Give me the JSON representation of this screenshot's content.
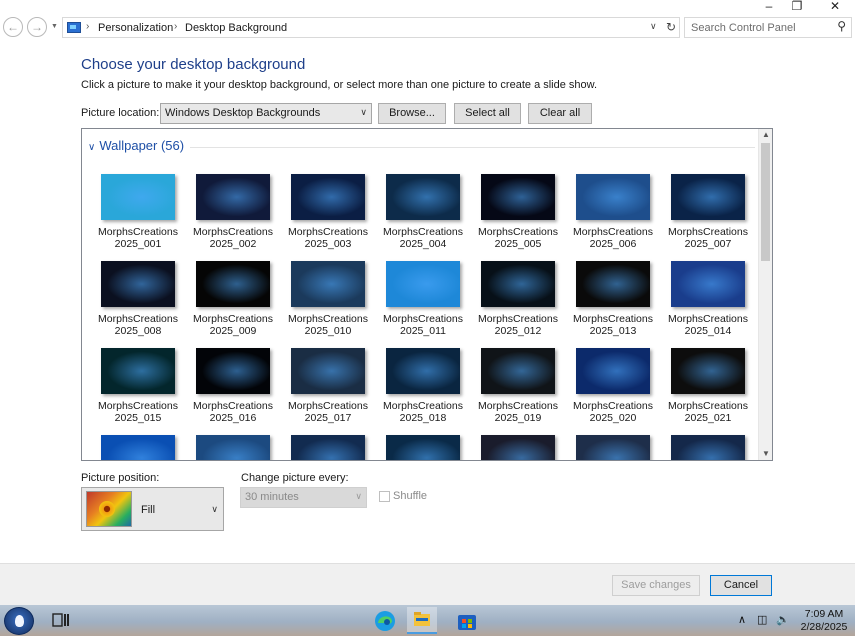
{
  "window": {
    "minimize": "–",
    "maximize": "❐",
    "close": "✕"
  },
  "address": {
    "crumbs": [
      "Personalization",
      "Desktop Background"
    ],
    "search_placeholder": "Search Control Panel"
  },
  "header": {
    "title": "Choose your desktop background",
    "instruction": "Click a picture to make it your desktop background, or select more than one picture to create a slide show."
  },
  "location": {
    "label": "Picture location:",
    "value": "Windows Desktop Backgrounds",
    "browse": "Browse...",
    "select_all": "Select all",
    "clear_all": "Clear all"
  },
  "gallery": {
    "group_title": "Wallpaper (56)",
    "items": [
      {
        "line1": "MorphsCreations",
        "line2": "2025_001"
      },
      {
        "line1": "MorphsCreations",
        "line2": "2025_002"
      },
      {
        "line1": "MorphsCreations",
        "line2": "2025_003"
      },
      {
        "line1": "MorphsCreations",
        "line2": "2025_004"
      },
      {
        "line1": "MorphsCreations",
        "line2": "2025_005"
      },
      {
        "line1": "MorphsCreations",
        "line2": "2025_006"
      },
      {
        "line1": "MorphsCreations",
        "line2": "2025_007"
      },
      {
        "line1": "MorphsCreations",
        "line2": "2025_008"
      },
      {
        "line1": "MorphsCreations",
        "line2": "2025_009"
      },
      {
        "line1": "MorphsCreations",
        "line2": "2025_010"
      },
      {
        "line1": "MorphsCreations",
        "line2": "2025_011"
      },
      {
        "line1": "MorphsCreations",
        "line2": "2025_012"
      },
      {
        "line1": "MorphsCreations",
        "line2": "2025_013"
      },
      {
        "line1": "MorphsCreations",
        "line2": "2025_014"
      },
      {
        "line1": "MorphsCreations",
        "line2": "2025_015"
      },
      {
        "line1": "MorphsCreations",
        "line2": "2025_016"
      },
      {
        "line1": "MorphsCreations",
        "line2": "2025_017"
      },
      {
        "line1": "MorphsCreations",
        "line2": "2025_018"
      },
      {
        "line1": "MorphsCreations",
        "line2": "2025_019"
      },
      {
        "line1": "MorphsCreations",
        "line2": "2025_020"
      },
      {
        "line1": "MorphsCreations",
        "line2": "2025_021"
      }
    ],
    "thumb_colors": [
      "#2aa7d9",
      "#101a3a",
      "#0b1e44",
      "#0d2b4a",
      "#050816",
      "#1e4e8c",
      "#0a2348",
      "#0b1020",
      "#050505",
      "#1b3a5c",
      "#1e88d8",
      "#071018",
      "#0a0a0a",
      "#1a3d8c",
      "#03262c",
      "#020408",
      "#1a2d44",
      "#0a2540",
      "#101418",
      "#0c2a6b",
      "#0d0d0d",
      "#0a4fb3",
      "#1c4a80",
      "#122b50",
      "#0a2a48",
      "#1a1c2c",
      "#1e2e4a",
      "#14284a"
    ]
  },
  "position": {
    "label": "Picture position:",
    "value": "Fill"
  },
  "interval": {
    "label": "Change picture every:",
    "value": "30 minutes",
    "shuffle": "Shuffle"
  },
  "footer": {
    "save": "Save changes",
    "cancel": "Cancel"
  },
  "taskbar": {
    "time": "7:09 AM",
    "date": "2/28/2025"
  }
}
